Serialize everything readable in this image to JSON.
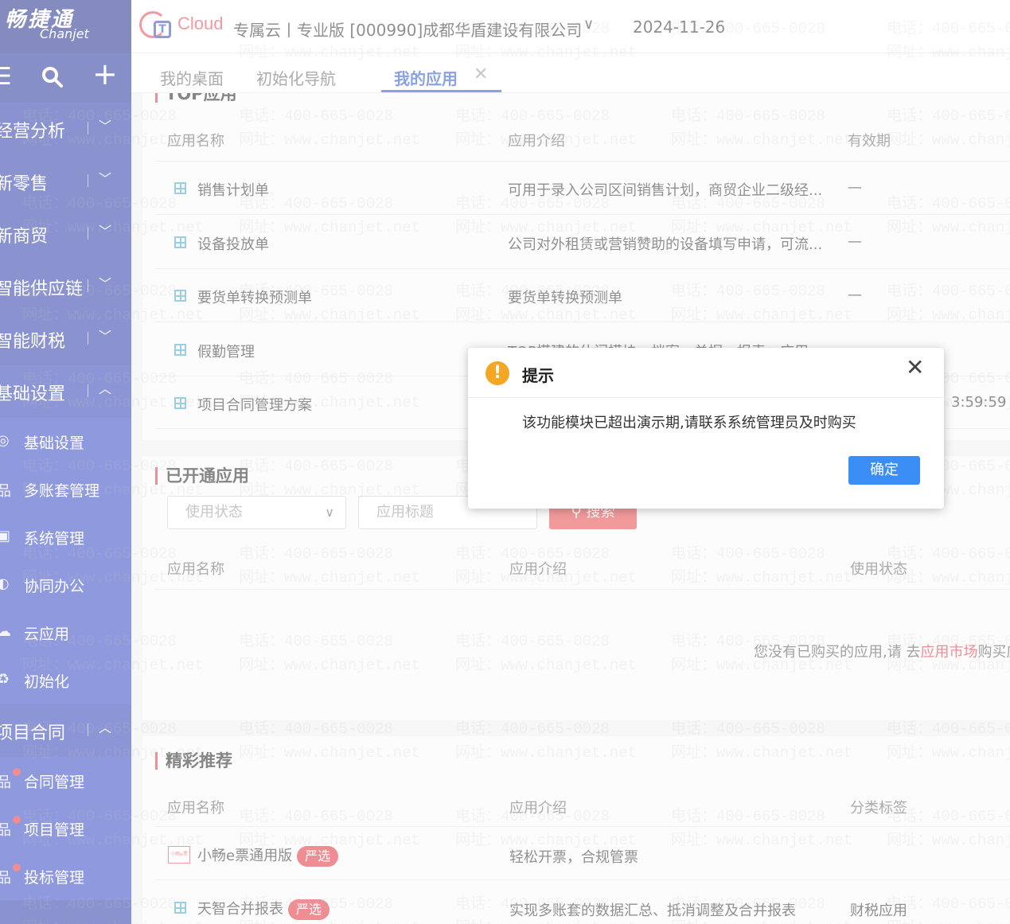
{
  "sidebar": {
    "logo_cn": "畅捷通",
    "logo_en": "Chanjet",
    "toolbar": {
      "menu_glyph": "☰",
      "search_glyph": "🔍",
      "add_glyph": "+"
    },
    "groups": [
      {
        "label": "经营分析"
      },
      {
        "label": "新零售"
      },
      {
        "label": "新商贸"
      },
      {
        "label": "智能供应链"
      },
      {
        "label": "智能财税"
      },
      {
        "label": "基础设置"
      }
    ],
    "basic_items": [
      {
        "label": "基础设置"
      },
      {
        "label": "多账套管理"
      },
      {
        "label": "系统管理"
      },
      {
        "label": "协同办公"
      },
      {
        "label": "云应用"
      },
      {
        "label": "初始化"
      }
    ],
    "project_group": {
      "label": "项目合同"
    },
    "project_items": [
      {
        "label": "合同管理"
      },
      {
        "label": "项目管理"
      },
      {
        "label": "投标管理"
      }
    ]
  },
  "header": {
    "brand": "Cloud",
    "org_text": "专属云丨专业版 [000990]成都华盾建设有限公司",
    "date": "2024-11-26"
  },
  "tabs": [
    {
      "label": "我的桌面"
    },
    {
      "label": "初始化导航"
    },
    {
      "label": "我的应用"
    }
  ],
  "top_apps": {
    "title": "TOP应用",
    "columns": [
      "应用名称",
      "应用介绍",
      "有效期"
    ],
    "rows": [
      {
        "name": "销售计划单",
        "desc": "可用于录入公司区间销售计划，商贸企业二级经...",
        "valid": "—"
      },
      {
        "name": "设备投放单",
        "desc": "公司对外租赁或营销赞助的设备填写申请，可流...",
        "valid": "—"
      },
      {
        "name": "要货单转换预测单",
        "desc": "要货单转换预测单",
        "valid": "—"
      },
      {
        "name": "假勤管理",
        "desc": "TOP搭建的休闲模块，档案、单据、报表、应用",
        "valid": ""
      },
      {
        "name": "项目合同管理方案",
        "desc": "",
        "valid": "3:59:59"
      }
    ]
  },
  "opened_apps": {
    "title": "已开通应用",
    "status_placeholder": "使用状态",
    "title_placeholder": "应用标题",
    "search_label": "搜索",
    "columns": [
      "应用名称",
      "应用介绍",
      "使用状态"
    ],
    "empty_prefix": "您没有已购买的应用,请 去",
    "empty_link": "应用市场",
    "empty_suffix": "购买应用"
  },
  "recommend": {
    "title": "精彩推荐",
    "columns": [
      "应用名称",
      "应用介绍",
      "分类标签"
    ],
    "rows": [
      {
        "name": "小畅e票通用版",
        "badge": "严选",
        "desc": "轻松开票，合规管票",
        "tag": ""
      },
      {
        "name": "天智合并报表",
        "badge": "严选",
        "desc": "实现多账套的数据汇总、抵消调整及合并报表",
        "tag": "财税应用"
      }
    ]
  },
  "modal": {
    "title": "提示",
    "message": "该功能模块已超出演示期,请联系系统管理员及时购买",
    "ok_label": "确定"
  },
  "watermark": {
    "phone": "电话：400-665-0028",
    "site": "网址：www.chanjet.net"
  },
  "colors": {
    "sidebar": "#2a3aa8",
    "accent_blue": "#2a55d0",
    "accent_red": "#e0303a",
    "ok_button": "#3a8ef5"
  }
}
